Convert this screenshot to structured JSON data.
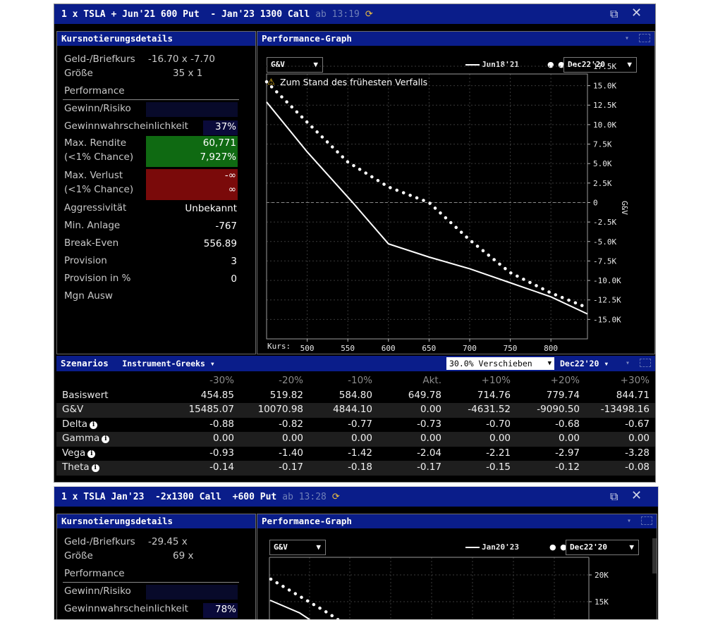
{
  "window1": {
    "title": "1 x TSLA + Jun'21 600 Put  - Jan'23 1300 Call",
    "timestamp": "ab 13:19",
    "quote": {
      "header": "Kursnotierungsdetails",
      "bid_ask_label": "Geld-/Briefkurs",
      "bid_ask_value": "-16.70 x -7.70",
      "size_label": "Größe",
      "size_value": "35 x 1",
      "performance_label": "Performance",
      "gain_risk_label": "Gewinn/Risiko",
      "prob_label": "Gewinnwahrscheinlichkeit",
      "prob_value": "37%",
      "max_return_label": "Max. Rendite",
      "max_return_sub": "(<1% Chance)",
      "max_return_value": "60,771",
      "max_return_pct": "7,927%",
      "max_loss_label": "Max. Verlust",
      "max_loss_sub": "(<1% Chance)",
      "max_loss_value": "-∞",
      "max_loss_value2": "∞",
      "aggr_label": "Aggressivität",
      "aggr_value": "Unbekannt",
      "min_inv_label": "Min. Anlage",
      "min_inv_value": "-767",
      "breakeven_label": "Break-Even",
      "breakeven_value": "556.89",
      "commission_label": "Provision",
      "commission_value": "3",
      "commission_pct_label": "Provision in %",
      "commission_pct_value": "0",
      "margin_label": "Mgn Ausw"
    },
    "graph": {
      "header": "Performance-Graph",
      "measure_select": "G&V",
      "legend_solid": "Jun18'21",
      "date_select": "Dec22'20",
      "warning": "Zum Stand des frühesten Verfalls",
      "y_axis_title": "G&V",
      "x_prefix": "Kurs: "
    },
    "scenarios": {
      "header": "Szenarios",
      "greeks_select": "Instrument-Greeks",
      "shift_select": "30.0% Verschieben",
      "date_select": "Dec22'20",
      "columns": [
        "-30%",
        "-20%",
        "-10%",
        "Akt.",
        "+10%",
        "+20%",
        "+30%"
      ],
      "rows": [
        {
          "label": "Basiswert",
          "info": false,
          "values": [
            "454.85",
            "519.82",
            "584.80",
            "649.78",
            "714.76",
            "779.74",
            "844.71"
          ]
        },
        {
          "label": "G&V",
          "info": false,
          "values": [
            "15485.07",
            "10070.98",
            "4844.10",
            "0.00",
            "-4631.52",
            "-9090.50",
            "-13498.16"
          ]
        },
        {
          "label": "Delta",
          "info": true,
          "values": [
            "-0.88",
            "-0.82",
            "-0.77",
            "-0.73",
            "-0.70",
            "-0.68",
            "-0.67"
          ]
        },
        {
          "label": "Gamma",
          "info": true,
          "values": [
            "0.00",
            "0.00",
            "0.00",
            "0.00",
            "0.00",
            "0.00",
            "0.00"
          ]
        },
        {
          "label": "Vega",
          "info": true,
          "values": [
            "-0.93",
            "-1.40",
            "-1.42",
            "-2.04",
            "-2.21",
            "-2.97",
            "-3.28"
          ]
        },
        {
          "label": "Theta",
          "info": true,
          "values": [
            "-0.14",
            "-0.17",
            "-0.18",
            "-0.17",
            "-0.15",
            "-0.12",
            "-0.08"
          ]
        }
      ]
    }
  },
  "window2": {
    "title": "1 x TSLA Jan'23  -2x1300 Call  +600 Put",
    "timestamp": "ab 13:28",
    "quote": {
      "header": "Kursnotierungsdetails",
      "bid_ask_label": "Geld-/Briefkurs",
      "bid_ask_value": "-29.45 x",
      "size_label": "Größe",
      "size_value": "69 x",
      "performance_label": "Performance",
      "gain_risk_label": "Gewinn/Risiko",
      "prob_label": "Gewinnwahrscheinlichkeit",
      "prob_value": "78%"
    },
    "graph": {
      "header": "Performance-Graph",
      "measure_select": "G&V",
      "legend_solid": "Jan20'23",
      "date_select": "Dec22'20"
    }
  },
  "chart_data": [
    {
      "type": "line",
      "ylabel": "G&V",
      "xlabel": "Kurs",
      "x_ticks": [
        500,
        550,
        600,
        650,
        700,
        750,
        800
      ],
      "y_ticks": [
        17500,
        15000,
        12500,
        10000,
        7500,
        5000,
        2500,
        0,
        -2500,
        -5000,
        -7500,
        -10000,
        -12500,
        -15000
      ],
      "y_tick_labels": [
        "17.5K",
        "15.0K",
        "12.5K",
        "10.0K",
        "7.5K",
        "5.0K",
        "2.5K",
        "0",
        "-2.5K",
        "-5.0K",
        "-7.5K",
        "-10.0K",
        "-12.5K",
        "-15.0K"
      ],
      "xlim": [
        450,
        845
      ],
      "ylim": [
        -17500,
        16500
      ],
      "series": [
        {
          "name": "Jun18'21",
          "style": "solid",
          "x": [
            450,
            500,
            556,
            600,
            650,
            700,
            750,
            800,
            845
          ],
          "y": [
            12900,
            6500,
            0,
            -5300,
            -7000,
            -8500,
            -10300,
            -12100,
            -14300
          ]
        },
        {
          "name": "Dec22'20",
          "style": "dotted",
          "x": [
            450,
            500,
            550,
            600,
            650,
            700,
            750,
            800,
            845
          ],
          "y": [
            15500,
            10300,
            5200,
            2000,
            0,
            -4800,
            -9000,
            -11600,
            -13500
          ]
        }
      ]
    },
    {
      "type": "line",
      "y_ticks": [
        20000,
        15000
      ],
      "y_tick_labels": [
        "20K",
        "15K"
      ],
      "series": [
        {
          "name": "Jan20'23",
          "style": "solid"
        },
        {
          "name": "Dec22'20",
          "style": "dotted"
        }
      ]
    }
  ]
}
